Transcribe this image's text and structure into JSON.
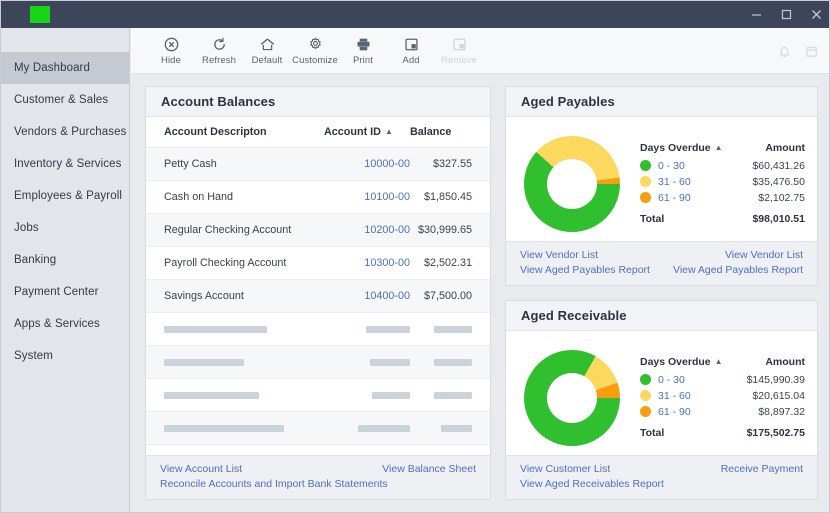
{
  "window": {
    "logo_color": "#16d616",
    "controls": [
      {
        "name": "minimize",
        "glyph": "–"
      },
      {
        "name": "maximize",
        "glyph": "□"
      },
      {
        "name": "close",
        "glyph": "✕"
      }
    ]
  },
  "toolbar": {
    "items": [
      {
        "label": "Hide",
        "icon": "close-circle-icon",
        "disabled": false
      },
      {
        "label": "Refresh",
        "icon": "refresh-icon",
        "disabled": false
      },
      {
        "label": "Default",
        "icon": "home-icon",
        "disabled": false
      },
      {
        "label": "Customize",
        "icon": "gear-icon",
        "disabled": false
      },
      {
        "label": "Print",
        "icon": "printer-icon",
        "disabled": false
      },
      {
        "label": "Add",
        "icon": "add-panel-icon",
        "disabled": false
      },
      {
        "label": "Remove",
        "icon": "remove-panel-icon",
        "disabled": true
      }
    ],
    "right_icons": [
      {
        "name": "bell-icon"
      },
      {
        "name": "calendar-icon"
      }
    ]
  },
  "sidebar": {
    "items": [
      {
        "label": "My Dashboard",
        "active": true
      },
      {
        "label": "Customer & Sales",
        "active": false
      },
      {
        "label": "Vendors & Purchases",
        "active": false
      },
      {
        "label": "Inventory & Services",
        "active": false
      },
      {
        "label": "Employees & Payroll",
        "active": false
      },
      {
        "label": "Jobs",
        "active": false
      },
      {
        "label": "Banking",
        "active": false
      },
      {
        "label": "Payment Center",
        "active": false
      },
      {
        "label": "Apps & Services",
        "active": false
      },
      {
        "label": "System",
        "active": false
      }
    ]
  },
  "account_balances": {
    "title": "Account Balances",
    "columns": {
      "description": "Account Descripton",
      "account_id": "Account ID",
      "balance": "Balance"
    },
    "sort_caret": "▲",
    "rows": [
      {
        "description": "Petty Cash",
        "account_id": "10000-00",
        "balance": "$327.55"
      },
      {
        "description": "Cash on Hand",
        "account_id": "10100-00",
        "balance": "$1,850.45"
      },
      {
        "description": "Regular Checking Account",
        "account_id": "10200-00",
        "balance": "$30,999.65"
      },
      {
        "description": "Payroll Checking Account",
        "account_id": "10300-00",
        "balance": "$2,502.31"
      },
      {
        "description": "Savings Account",
        "account_id": "10400-00",
        "balance": "$7,500.00"
      }
    ],
    "placeholder_rows": [
      {
        "desc_w": 103,
        "id_w": 44,
        "bal_w": 38
      },
      {
        "desc_w": 80,
        "id_w": 40,
        "bal_w": 38
      },
      {
        "desc_w": 95,
        "id_w": 38,
        "bal_w": 38
      },
      {
        "desc_w": 120,
        "id_w": 52,
        "bal_w": 31
      },
      {
        "desc_w": 104,
        "id_w": 45,
        "bal_w": 29
      }
    ],
    "footer": {
      "left_top": "View Account List",
      "right_top": "View Balance Sheet",
      "left_bottom": "Reconcile Accounts and Import Bank Statements"
    }
  },
  "aged_payables": {
    "title": "Aged Payables",
    "columns": {
      "bucket": "Days Overdue",
      "amount": "Amount"
    },
    "sort_caret": "▲",
    "buckets": [
      {
        "label": "0 - 30",
        "amount": "$60,431.26",
        "color": "#30bf2f",
        "pct": 61.7
      },
      {
        "label": "31 - 60",
        "amount": "$35,476.50",
        "color": "#fcd95e",
        "pct": 36.2
      },
      {
        "label": "61 - 90",
        "amount": "$2,102.75",
        "color": "#f89d0e",
        "pct": 2.1
      }
    ],
    "total_label": "Total",
    "total_amount": "$98,010.51",
    "footer": {
      "left_top": "View Vendor List",
      "right_top": "View Vendor List",
      "left_bottom": "View Aged Payables Report",
      "right_bottom": "View Aged Payables Report"
    }
  },
  "aged_receivable": {
    "title": "Aged Receivable",
    "columns": {
      "bucket": "Days Overdue",
      "amount": "Amount"
    },
    "sort_caret": "▲",
    "buckets": [
      {
        "label": "0 - 30",
        "amount": "$145,990.39",
        "color": "#30bf2f",
        "pct": 83.2
      },
      {
        "label": "31 - 60",
        "amount": "$20,615.04",
        "color": "#fcd95e",
        "pct": 11.7
      },
      {
        "label": "61 - 90",
        "amount": "$8,897.32",
        "color": "#f89d0e",
        "pct": 5.1
      }
    ],
    "total_label": "Total",
    "total_amount": "$175,502.75",
    "footer": {
      "left_top": "View Customer List",
      "right_top": "Receive Payment",
      "left_bottom": "View Aged Receivables Report"
    }
  },
  "chart_data": [
    {
      "type": "pie",
      "title": "Aged Payables",
      "categories": [
        "0 - 30",
        "31 - 60",
        "61 - 90"
      ],
      "values": [
        60431.26,
        35476.5,
        2102.75
      ],
      "colors": [
        "#30bf2f",
        "#fcd95e",
        "#f89d0e"
      ],
      "total": 98010.51,
      "legend_position": "right",
      "donut": true
    },
    {
      "type": "pie",
      "title": "Aged Receivable",
      "categories": [
        "0 - 30",
        "31 - 60",
        "61 - 90"
      ],
      "values": [
        145990.39,
        20615.04,
        8897.32
      ],
      "colors": [
        "#30bf2f",
        "#fcd95e",
        "#f89d0e"
      ],
      "total": 175502.75,
      "legend_position": "right",
      "donut": true
    }
  ]
}
